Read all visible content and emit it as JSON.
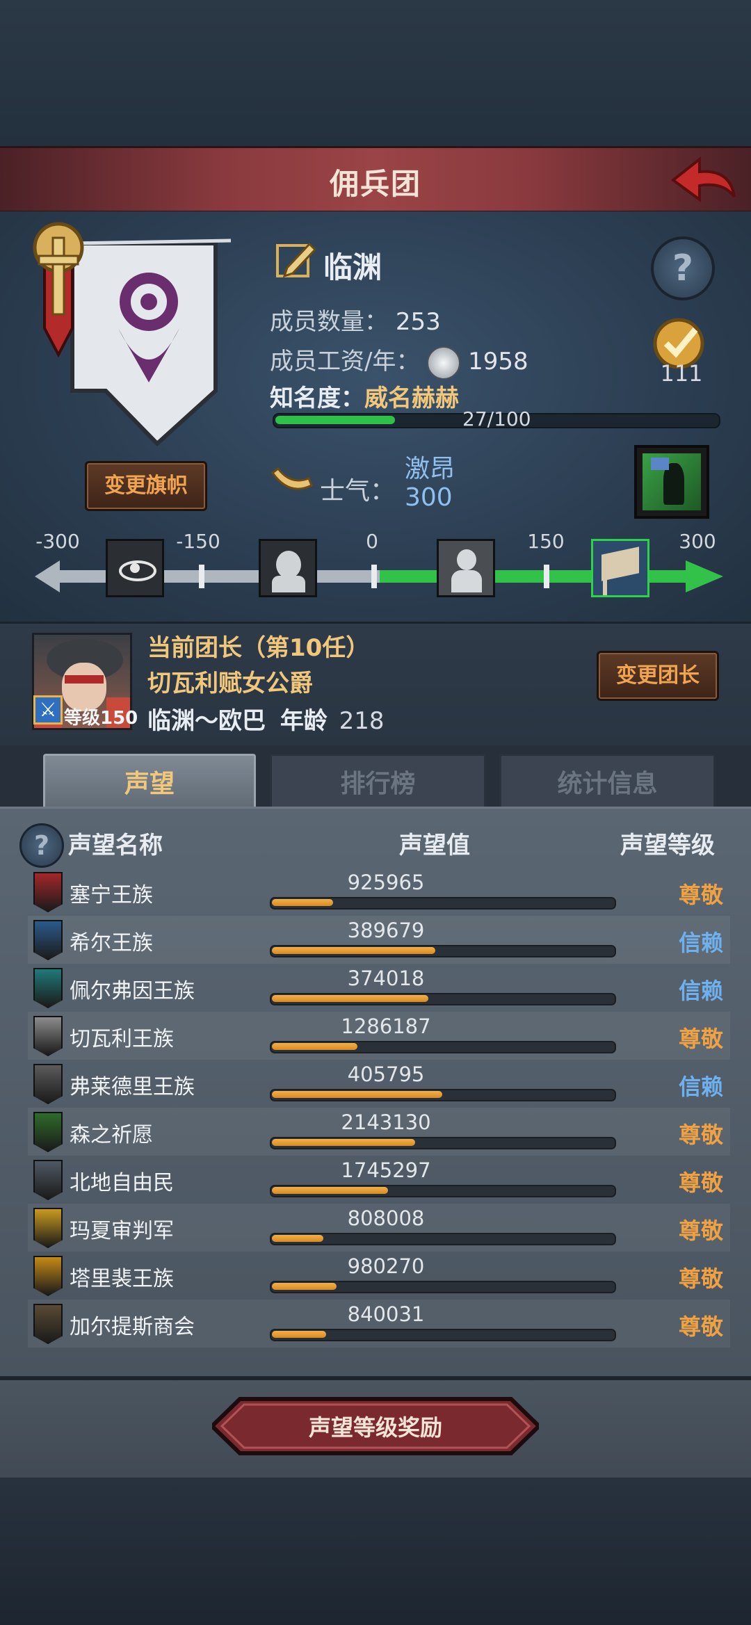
{
  "header": {
    "title": "佣兵团"
  },
  "guild": {
    "name": "临渊",
    "members_label": "成员数量：",
    "members_value": "253",
    "salary_label": "成员工资/年：",
    "salary_value": "1958",
    "fame_label": "知名度：",
    "fame_value": "威名赫赫",
    "fame_progress_text": "27/100",
    "fame_progress": 0.27,
    "badge_count": "111",
    "change_banner_label": "变更旗帜"
  },
  "morale": {
    "label": "士气：",
    "state": "激昂",
    "value": "300",
    "scale_labels": [
      "-300",
      "-150",
      "0",
      "150",
      "300"
    ],
    "level": 300
  },
  "leader": {
    "title": "当前团长（第10任）",
    "name": "切瓦利赋女公爵",
    "level_text": "等级150",
    "origin": "临渊～欧巴",
    "age_label": "年龄",
    "age_value": "218",
    "change_leader_label": "变更团长"
  },
  "tabs": [
    {
      "label": "声望",
      "active": true
    },
    {
      "label": "排行榜",
      "active": false
    },
    {
      "label": "统计信息",
      "active": false
    }
  ],
  "table": {
    "headers": {
      "name": "声望名称",
      "value": "声望值",
      "level": "声望等级"
    },
    "rows": [
      {
        "name": "塞宁王族",
        "value": "925965",
        "level": "尊敬",
        "progress": 0.18,
        "icon": "red-banner-icon",
        "color": "#a3262a",
        "level_color": "#f0a243"
      },
      {
        "name": "希尔王族",
        "value": "389679",
        "level": "信赖",
        "progress": 0.48,
        "icon": "blue-crest-icon",
        "color": "#2b5a8a",
        "level_color": "#6fb0ee"
      },
      {
        "name": "佩尔弗因王族",
        "value": "374018",
        "level": "信赖",
        "progress": 0.46,
        "icon": "teal-moon-icon",
        "color": "#1f7a78",
        "level_color": "#6fb0ee"
      },
      {
        "name": "切瓦利王族",
        "value": "1286187",
        "level": "尊敬",
        "progress": 0.25,
        "icon": "scales-icon",
        "color": "#8c8c8c",
        "level_color": "#f0a243"
      },
      {
        "name": "弗莱德里王族",
        "value": "405795",
        "level": "信赖",
        "progress": 0.5,
        "icon": "knight-icon",
        "color": "#5b5b5b",
        "level_color": "#6fb0ee"
      },
      {
        "name": "森之祈愿",
        "value": "2143130",
        "level": "尊敬",
        "progress": 0.42,
        "icon": "tree-icon",
        "color": "#2f6b2a",
        "level_color": "#f0a243"
      },
      {
        "name": "北地自由民",
        "value": "1745297",
        "level": "尊敬",
        "progress": 0.34,
        "icon": "axe-icon",
        "color": "#4f5863",
        "level_color": "#f0a243"
      },
      {
        "name": "玛夏审判军",
        "value": "808008",
        "level": "尊敬",
        "progress": 0.15,
        "icon": "cross-shield-icon",
        "color": "#c99a1c",
        "level_color": "#f0a243"
      },
      {
        "name": "塔里裴王族",
        "value": "980270",
        "level": "尊敬",
        "progress": 0.19,
        "icon": "crown-shield-icon",
        "color": "#c58a16",
        "level_color": "#f0a243"
      },
      {
        "name": "加尔提斯商会",
        "value": "840031",
        "level": "尊敬",
        "progress": 0.16,
        "icon": "chest-icon",
        "color": "#5a4a34",
        "level_color": "#f0a243"
      }
    ]
  },
  "bottom": {
    "reward_button_label": "声望等级奖励"
  }
}
